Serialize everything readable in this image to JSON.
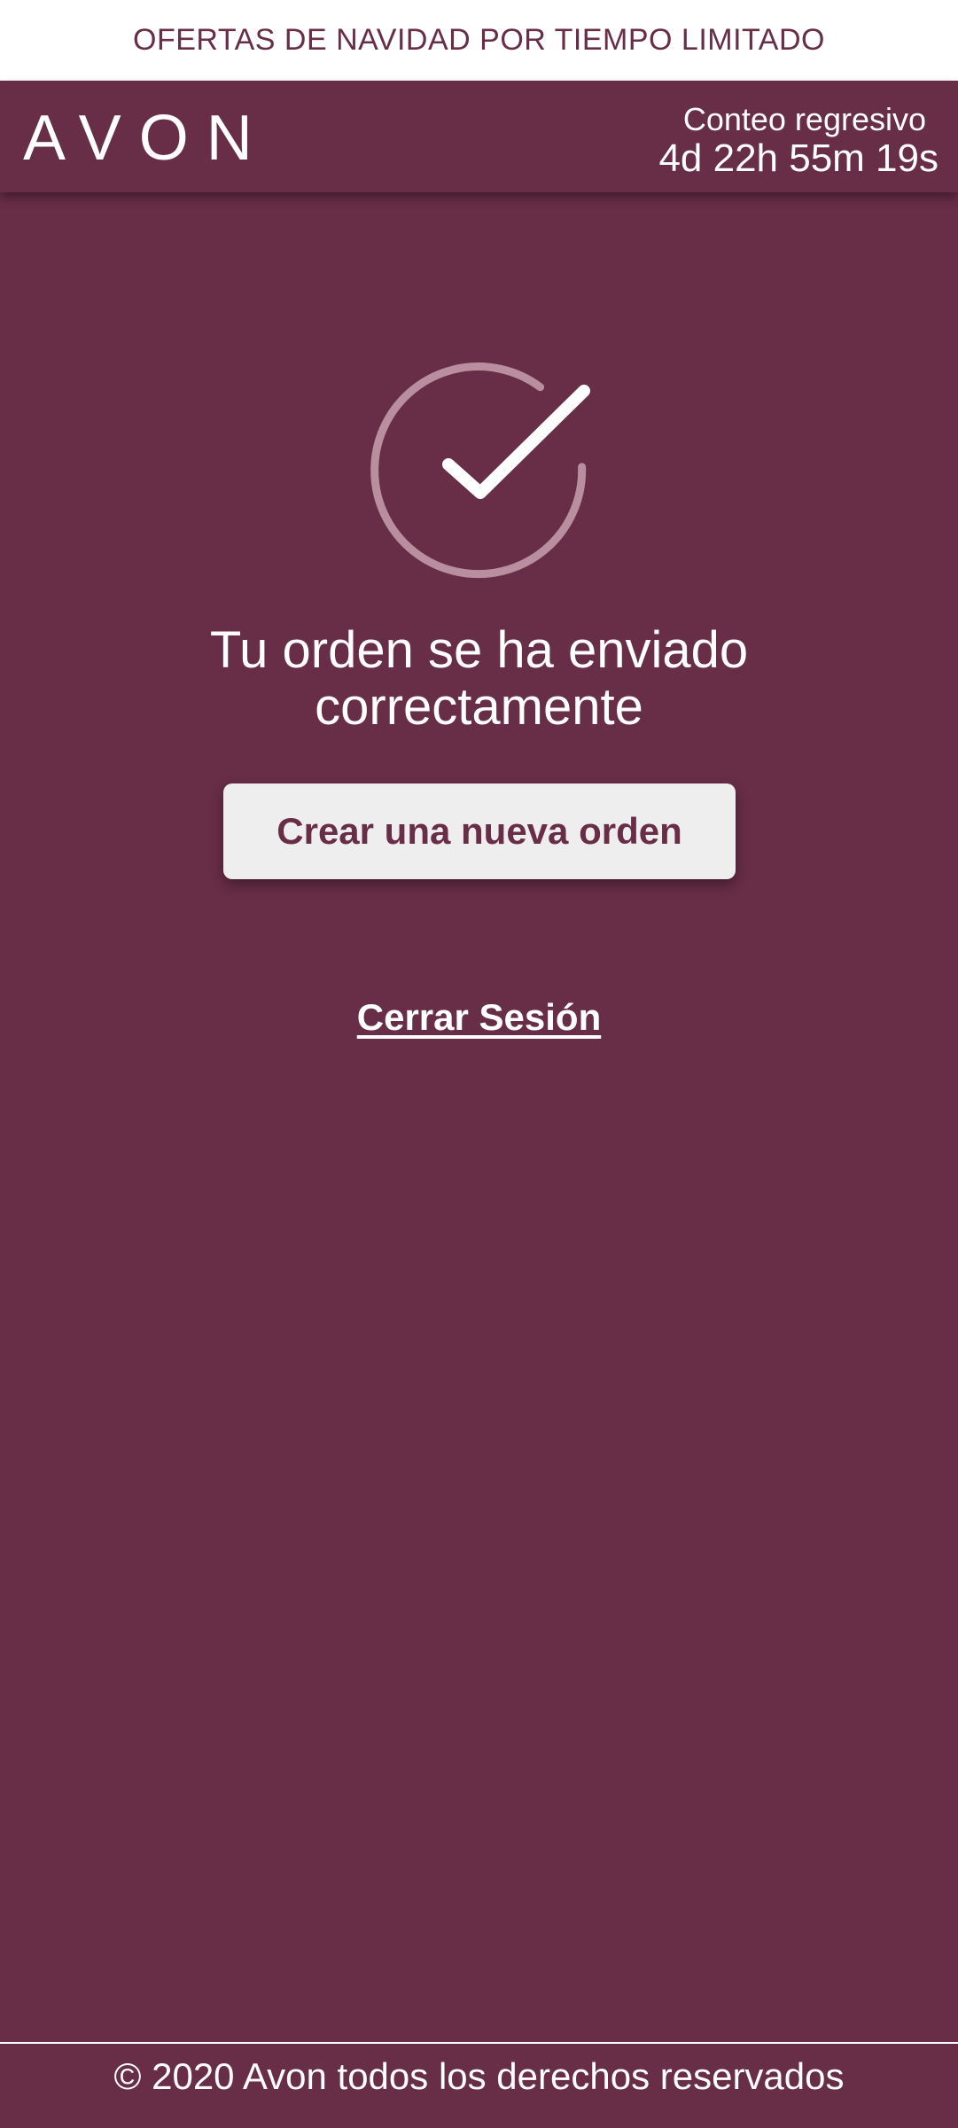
{
  "promo": {
    "text": "OFERTAS DE NAVIDAD POR TIEMPO LIMITADO"
  },
  "header": {
    "logo_text": "AVON",
    "countdown_label": "Conteo regresivo",
    "countdown_value": "4d 22h 55m 19s"
  },
  "main": {
    "icon": "check-circle-icon",
    "title_line1": "Tu orden se ha enviado",
    "title_line2": "correctamente",
    "new_order_label": "Crear una nueva orden",
    "logout_label": "Cerrar Sesión"
  },
  "footer": {
    "text": "© 2020 Avon todos los derechos reservados"
  },
  "colors": {
    "brand": "#682d47",
    "button_bg": "#efeeee",
    "text_light": "#ffffff"
  }
}
